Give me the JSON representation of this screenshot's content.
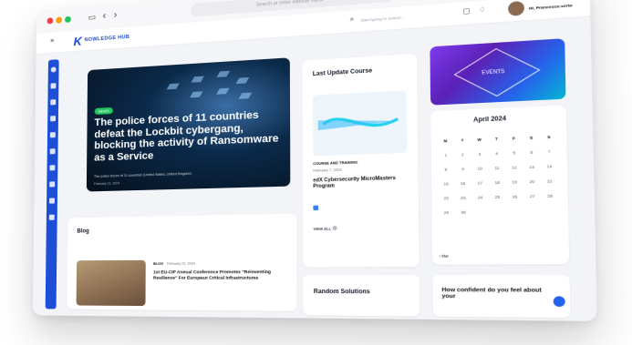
{
  "browser": {
    "url_placeholder": "Search or enter website name"
  },
  "app": {
    "logo_letter": "K",
    "logo_text": "NOWLEDGE HUB",
    "search_placeholder": "Start typing to search...",
    "user_name": "Hi, Francesco.verto"
  },
  "hero": {
    "tag": "NEWS",
    "title": "The police forces of 11 countries defeat the Lockbit cybergang, blocking the activity of Ransomware as a Service",
    "subtitle": "The police forces of 11 countries (United States, United Kingdom,",
    "date": "February 21, 2024"
  },
  "course": {
    "section_title": "Last Update Course",
    "category": "COURSE AND TRAINING",
    "date": "February 7, 2024",
    "title": "edX Cybersecurity MicroMasters Program",
    "view_all": "VIEW ALL"
  },
  "events": {
    "label": "EVENTS"
  },
  "calendar": {
    "month": "April 2024",
    "weekdays": [
      "M",
      "T",
      "W",
      "T",
      "F",
      "S",
      "S"
    ],
    "days": [
      "1",
      "2",
      "3",
      "4",
      "5",
      "6",
      "7",
      "8",
      "9",
      "10",
      "11",
      "12",
      "13",
      "14",
      "15",
      "16",
      "17",
      "18",
      "19",
      "20",
      "21",
      "22",
      "23",
      "24",
      "25",
      "26",
      "27",
      "28",
      "29",
      "30"
    ],
    "prev_label": "Mar"
  },
  "blog": {
    "section_title": "Blog",
    "category": "BLOG",
    "date": "February 22, 2024",
    "post_title": "1st EU-CIP Annual Conference Promotes \"Reinventing Resilience\" For European Critical Infrastructures"
  },
  "random": {
    "section_title": "Random Solutions"
  },
  "survey": {
    "question": "How confident do you feel about your"
  },
  "icons": [
    "menu-icon",
    "search-icon",
    "chat-icon",
    "bell-icon",
    "plus-icon",
    "tabs-icon",
    "share-icon",
    "back-icon",
    "forward-icon",
    "view-all-icon"
  ]
}
